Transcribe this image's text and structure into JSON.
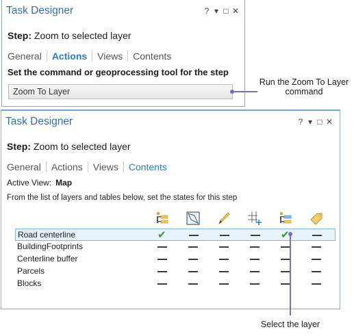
{
  "top_pane": {
    "title": "Task Designer",
    "window_buttons": [
      "?",
      "▾",
      "□",
      "✕"
    ],
    "step_label": "Step:",
    "step_value": "Zoom to selected layer",
    "tabs": [
      {
        "label": "General"
      },
      {
        "label": "Actions",
        "active": true
      },
      {
        "label": "Views"
      },
      {
        "label": "Contents"
      }
    ],
    "command_heading": "Set the command or geoprocessing tool for the step",
    "command_value": "Zoom To Layer"
  },
  "bottom_pane": {
    "title": "Task Designer",
    "window_buttons": [
      "?",
      "▾",
      "□",
      "✕"
    ],
    "step_label": "Step:",
    "step_value": "Zoom to selected layer",
    "tabs": [
      {
        "label": "General"
      },
      {
        "label": "Actions"
      },
      {
        "label": "Views"
      },
      {
        "label": "Contents",
        "active": true
      }
    ],
    "active_view_label": "Active View:",
    "active_view_value": "Map",
    "instructions": "From the list of layers and tables below, set the states for this step",
    "columns": [
      {
        "icon": "layer-visibility-icon"
      },
      {
        "icon": "selectable-icon"
      },
      {
        "icon": "editable-icon"
      },
      {
        "icon": "snappable-icon"
      },
      {
        "icon": "selected-layer-icon"
      },
      {
        "icon": "tag-icon"
      }
    ],
    "layers": [
      {
        "name": "Road centerline",
        "states": [
          "check",
          "dash",
          "dash",
          "dash",
          "check",
          "dash"
        ],
        "selected": true
      },
      {
        "name": "BuildingFootprints",
        "states": [
          "dash",
          "dash",
          "dash",
          "dash",
          "dash",
          "dash"
        ]
      },
      {
        "name": "Centerline buffer",
        "states": [
          "dash",
          "dash",
          "dash",
          "dash",
          "dash",
          "dash"
        ]
      },
      {
        "name": "Parcels",
        "states": [
          "dash",
          "dash",
          "dash",
          "dash",
          "dash",
          "dash"
        ]
      },
      {
        "name": "Blocks",
        "states": [
          "dash",
          "dash",
          "dash",
          "dash",
          "dash",
          "dash"
        ]
      }
    ]
  },
  "callouts": {
    "command": "Run the Zoom To Layer command",
    "select_layer": "Select the layer"
  },
  "colors": {
    "title_blue": "#2e6faf",
    "tab_active": "#2b79c2",
    "check_green": "#2e9a3c",
    "callout": "#7a6cc4",
    "selected_row": "#e8f2fb"
  }
}
